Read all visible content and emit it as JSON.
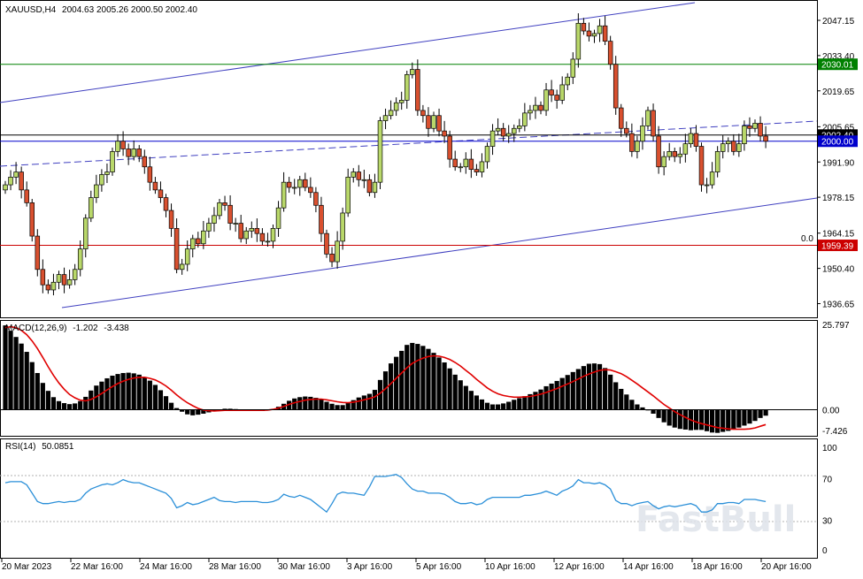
{
  "chart_data": [
    {
      "type": "candlestick",
      "title": "XAUUSD,H4",
      "ohlc_header": "2004.63 2005.26 2000.50 2002.40",
      "ylim": [
        1930,
        2055
      ],
      "y_ticks": [
        1936.65,
        1950.4,
        1964.15,
        1978.15,
        1991.9,
        2005.65,
        2019.65,
        2033.4,
        2047.15
      ],
      "x_ticks": [
        "20 Mar 2023",
        "22 Mar 16:00",
        "24 Mar 16:00",
        "28 Mar 16:00",
        "30 Mar 16:00",
        "3 Apr 16:00",
        "5 Apr 16:00",
        "10 Apr 16:00",
        "12 Apr 16:00",
        "14 Apr 16:00",
        "18 Apr 16:00",
        "20 Apr 16:00"
      ],
      "price_levels": [
        {
          "label": "2030.01",
          "value": 2030.01,
          "color": "#008000"
        },
        {
          "label": "2002.40",
          "value": 2002.4,
          "color": "#000000"
        },
        {
          "label": "2000.00",
          "value": 2000.0,
          "color": "#0000cc"
        },
        {
          "label": "1959.39",
          "value": 1959.39,
          "color": "#cc0000"
        }
      ],
      "fib_label": "0.0",
      "close": [
        1983,
        1986,
        1988,
        1981,
        1976,
        1963,
        1950,
        1944,
        1942,
        1945,
        1948,
        1944,
        1946,
        1950,
        1958,
        1970,
        1978,
        1983,
        1987,
        1988,
        1996,
        2000,
        1997,
        1994,
        1997,
        1994,
        1990,
        1984,
        1981,
        1978,
        1973,
        1966,
        1950,
        1952,
        1958,
        1962,
        1960,
        1965,
        1968,
        1971,
        1976,
        1975,
        1968,
        1968,
        1962,
        1965,
        1966,
        1964,
        1961,
        1961,
        1966,
        1974,
        1984,
        1982,
        1982,
        1985,
        1982,
        1980,
        1975,
        1964,
        1956,
        1953,
        1961,
        1972,
        1986,
        1988,
        1985,
        1985,
        1980,
        1984,
        2008,
        2010,
        2012,
        2015,
        2016,
        2026,
        2028,
        2012,
        2010,
        2005,
        2010,
        2004,
        2002,
        1993,
        1990,
        1990,
        1993,
        1989,
        1988,
        1992,
        1998,
        2004,
        2005,
        2002,
        2003,
        2005,
        2006,
        2011,
        2012,
        2014,
        2012,
        2020,
        2018,
        2016,
        2022,
        2025,
        2032,
        2046,
        2043,
        2041,
        2042,
        2045,
        2039,
        2030,
        2013,
        2005,
        2003,
        1996,
        2000,
        2006,
        2012,
        2002,
        1990,
        1994,
        1996,
        1994,
        1995,
        1999,
        2003,
        1998,
        1983,
        1983,
        1988,
        1996,
        1999,
        2000,
        1996,
        1999,
        2006,
        2005,
        2007,
        2002,
        2000
      ],
      "macd": {
        "name": "MACD(12,26,9)",
        "values": [
          -1.202,
          -3.438
        ],
        "scale_ticks": [
          "25.797",
          "0.00",
          "-7.426"
        ]
      },
      "macd_hist": [
        25.5,
        23.9,
        22.0,
        20.0,
        17.5,
        14.4,
        11.1,
        8.1,
        5.7,
        3.8,
        2.6,
        2.0,
        1.7,
        1.9,
        2.6,
        3.9,
        5.8,
        7.3,
        8.5,
        9.5,
        10.3,
        10.8,
        11.1,
        11.2,
        11.0,
        10.6,
        9.9,
        8.8,
        7.5,
        5.9,
        4.1,
        2.1,
        0.5,
        -0.6,
        -1.4,
        -1.7,
        -1.5,
        -1.2,
        -0.8,
        -0.3,
        0.1,
        0.3,
        0.3,
        0.2,
        0.0,
        -0.2,
        -0.3,
        -0.4,
        -0.4,
        -0.2,
        0.2,
        0.9,
        1.8,
        2.7,
        3.4,
        3.8,
        4.0,
        3.9,
        3.6,
        3.1,
        2.4,
        1.8,
        1.4,
        1.4,
        2.0,
        2.9,
        3.7,
        4.3,
        4.8,
        6.0,
        9.0,
        11.6,
        14.0,
        16.0,
        17.8,
        19.6,
        20.2,
        19.9,
        19.3,
        18.4,
        17.2,
        15.8,
        14.3,
        12.5,
        10.6,
        8.9,
        7.2,
        5.7,
        4.3,
        3.1,
        2.1,
        1.6,
        1.6,
        1.9,
        2.4,
        3.0,
        3.5,
        4.1,
        4.7,
        5.4,
        6.1,
        7.1,
        7.9,
        8.7,
        9.6,
        10.5,
        11.4,
        12.3,
        13.2,
        13.9,
        14.0,
        13.8,
        12.6,
        10.6,
        8.3,
        6.3,
        4.6,
        3.0,
        1.6,
        0.7,
        -0.2,
        -1.2,
        -2.5,
        -3.8,
        -4.8,
        -5.4,
        -5.8,
        -6.0,
        -6.2,
        -6.1,
        -6.1,
        -6.5,
        -6.9,
        -7.0,
        -6.7,
        -6.4,
        -6.0,
        -5.4,
        -4.8,
        -4.2,
        -3.4,
        -2.5,
        -1.8
      ],
      "macd_signal": [
        24.8,
        25.1,
        24.8,
        24.0,
        22.7,
        20.8,
        18.5,
        15.8,
        13.0,
        10.4,
        8.1,
        6.2,
        4.6,
        3.6,
        2.9,
        2.7,
        3.1,
        3.9,
        4.9,
        6.0,
        7.0,
        7.9,
        8.6,
        9.2,
        9.6,
        9.8,
        9.8,
        9.5,
        9.0,
        8.2,
        7.2,
        5.9,
        4.5,
        3.2,
        2.1,
        1.2,
        0.4,
        -0.1,
        -0.3,
        -0.4,
        -0.3,
        -0.2,
        -0.2,
        -0.2,
        -0.2,
        -0.2,
        -0.2,
        -0.2,
        -0.2,
        -0.1,
        0.1,
        0.5,
        1.0,
        1.6,
        2.1,
        2.5,
        2.9,
        3.1,
        3.2,
        3.2,
        3.0,
        2.7,
        2.4,
        2.2,
        2.1,
        2.3,
        2.6,
        3.0,
        3.4,
        3.9,
        5.0,
        6.4,
        7.9,
        9.5,
        11.1,
        12.7,
        14.0,
        14.9,
        15.6,
        16.1,
        16.3,
        16.2,
        15.8,
        15.2,
        14.3,
        13.2,
        11.9,
        10.6,
        9.2,
        7.9,
        6.6,
        5.6,
        4.8,
        4.3,
        4.0,
        3.8,
        3.8,
        3.9,
        4.0,
        4.3,
        4.7,
        5.2,
        5.8,
        6.4,
        7.1,
        7.8,
        8.5,
        9.3,
        10.1,
        10.8,
        11.4,
        11.9,
        12.1,
        12.0,
        11.5,
        10.9,
        10.0,
        8.9,
        7.8,
        6.6,
        5.4,
        4.2,
        2.9,
        1.6,
        0.5,
        -0.6,
        -1.5,
        -2.3,
        -3.1,
        -3.7,
        -4.2,
        -4.6,
        -5.0,
        -5.4,
        -5.6,
        -5.8,
        -5.9,
        -5.9,
        -5.9,
        -5.8,
        -5.5,
        -5.0,
        -4.5
      ],
      "rsi": {
        "name": "RSI(14)",
        "value": 50.0851,
        "scale_ticks": [
          "100",
          "70",
          "30",
          "0"
        ]
      },
      "rsi_values": [
        66,
        67,
        67,
        67,
        64,
        56,
        48,
        46,
        46,
        47,
        48,
        47,
        48,
        48,
        50,
        56,
        60,
        62,
        64,
        65,
        64,
        66,
        69,
        67,
        66,
        66,
        64,
        62,
        60,
        58,
        56,
        51,
        42,
        44,
        47,
        45,
        46,
        48,
        50,
        52,
        49,
        48,
        48,
        47,
        48,
        48,
        48,
        48,
        47,
        47,
        48,
        50,
        55,
        53,
        52,
        54,
        52,
        50,
        46,
        42,
        38,
        46,
        55,
        57,
        56,
        56,
        55,
        54,
        62,
        72,
        72,
        72,
        73,
        74,
        71,
        65,
        60,
        58,
        58,
        56,
        56,
        56,
        55,
        52,
        48,
        46,
        46,
        47,
        45,
        46,
        50,
        52,
        52,
        52,
        52,
        52,
        52,
        54,
        54,
        55,
        56,
        58,
        56,
        54,
        58,
        60,
        63,
        69,
        66,
        66,
        65,
        66,
        64,
        60,
        49,
        46,
        46,
        44,
        46,
        47,
        48,
        44,
        41,
        43,
        44,
        43,
        44,
        45,
        46,
        44,
        38,
        38,
        40,
        46,
        46,
        47,
        47,
        46,
        50,
        50,
        50,
        49,
        48
      ],
      "watermark": "FastBull"
    }
  ]
}
